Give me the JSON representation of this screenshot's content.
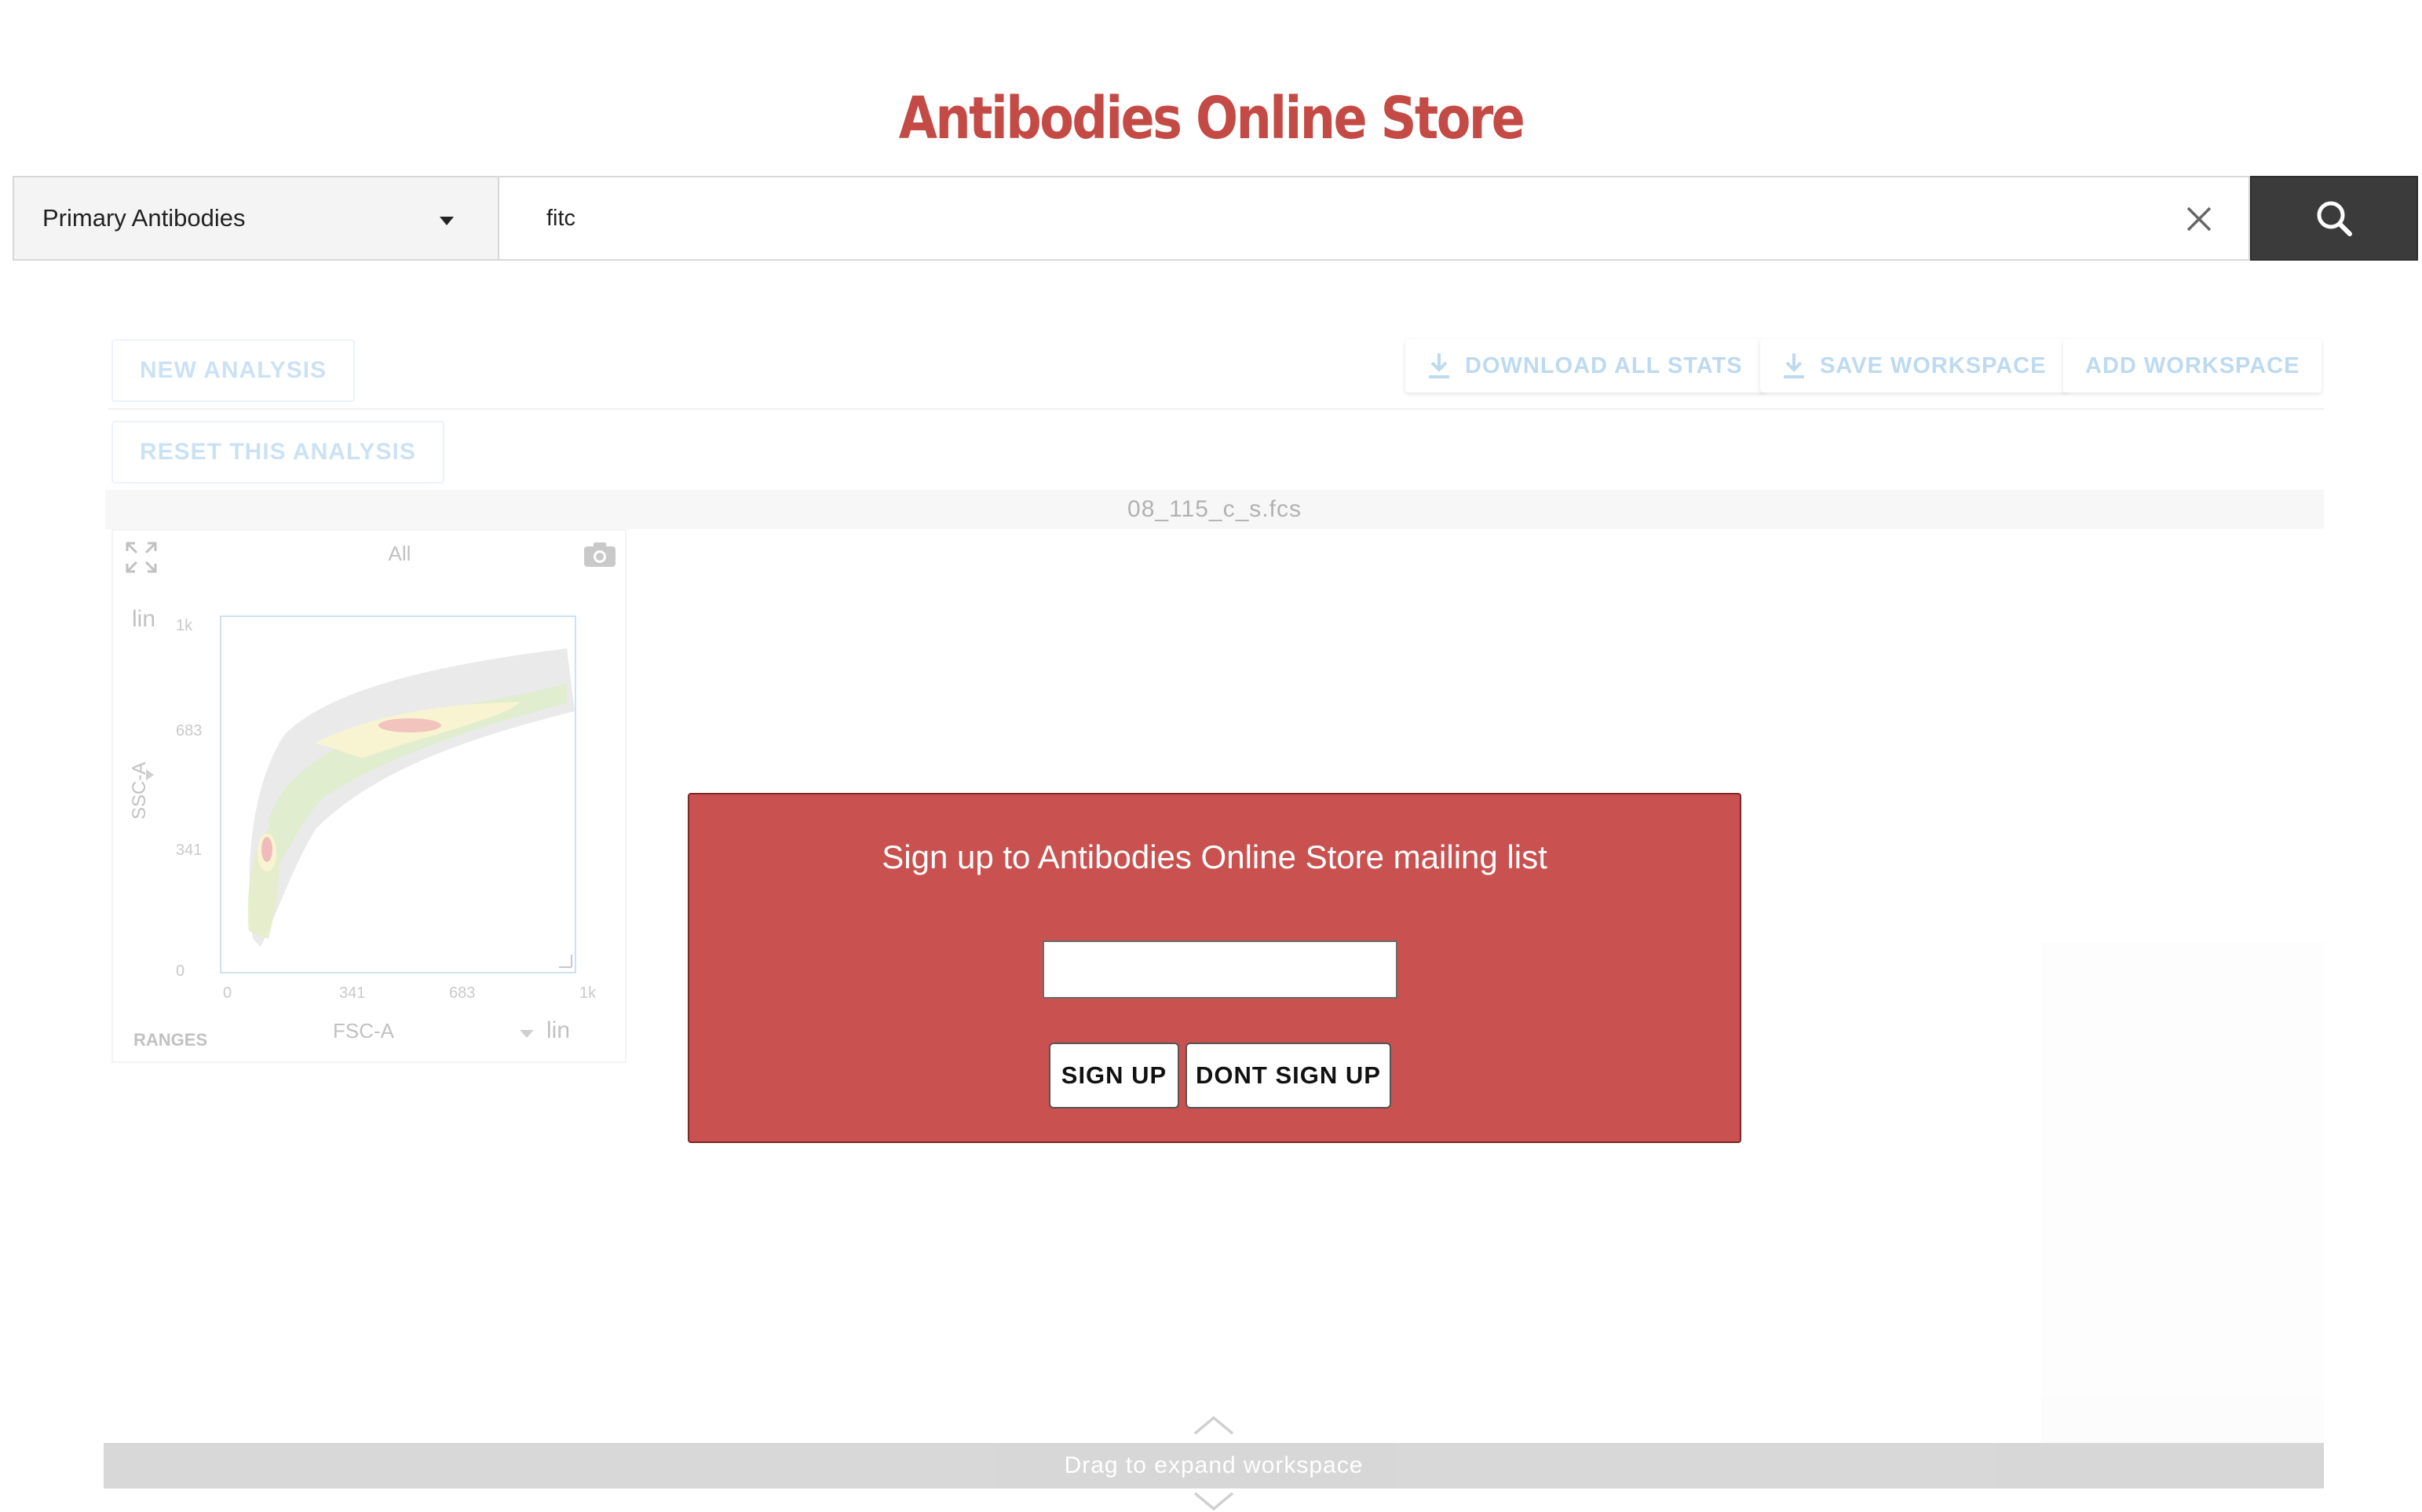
{
  "header": {
    "title": "Antibodies Online Store"
  },
  "search": {
    "category": "Primary Antibodies",
    "query": "fitc"
  },
  "toolbar": {
    "new_analysis": "NEW ANALYSIS",
    "reset_analysis": "RESET THIS ANALYSIS",
    "download_all_stats": "DOWNLOAD ALL STATS",
    "save_workspace": "SAVE WORKSPACE",
    "add_workspace": "ADD WORKSPACE"
  },
  "file": {
    "name": "08_115_c_s.fcs"
  },
  "plot": {
    "gate": "All",
    "y_scale": "lin",
    "x_scale": "lin",
    "y_axis": "SSC-A",
    "x_axis": "FSC-A",
    "ranges_label": "RANGES",
    "y_ticks": [
      "1k",
      "683",
      "341",
      "0"
    ],
    "x_ticks": [
      "0",
      "341",
      "683",
      "1k"
    ]
  },
  "workspace": {
    "drag_label": "Drag to expand workspace"
  },
  "modal": {
    "title": "Sign up to Antibodies Online Store mailing list",
    "email_value": "",
    "sign_up": "SIGN UP",
    "dont_sign_up": "DONT SIGN UP",
    "background_color": "#c9514f"
  },
  "icons": {
    "search": "search-icon",
    "clear": "close-icon",
    "dropdown": "caret-down-icon",
    "download": "download-icon",
    "expand": "expand-icon",
    "camera": "camera-icon",
    "chevron_up": "chevron-up-icon",
    "chevron_down": "chevron-down-icon"
  }
}
